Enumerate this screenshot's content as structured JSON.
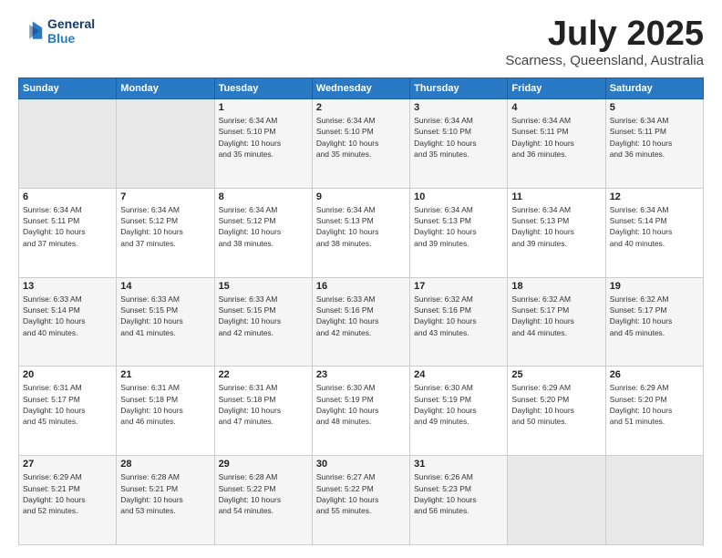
{
  "logo": {
    "line1": "General",
    "line2": "Blue"
  },
  "header": {
    "month": "July 2025",
    "location": "Scarness, Queensland, Australia"
  },
  "weekdays": [
    "Sunday",
    "Monday",
    "Tuesday",
    "Wednesday",
    "Thursday",
    "Friday",
    "Saturday"
  ],
  "weeks": [
    [
      {
        "day": "",
        "info": ""
      },
      {
        "day": "",
        "info": ""
      },
      {
        "day": "1",
        "info": "Sunrise: 6:34 AM\nSunset: 5:10 PM\nDaylight: 10 hours\nand 35 minutes."
      },
      {
        "day": "2",
        "info": "Sunrise: 6:34 AM\nSunset: 5:10 PM\nDaylight: 10 hours\nand 35 minutes."
      },
      {
        "day": "3",
        "info": "Sunrise: 6:34 AM\nSunset: 5:10 PM\nDaylight: 10 hours\nand 35 minutes."
      },
      {
        "day": "4",
        "info": "Sunrise: 6:34 AM\nSunset: 5:11 PM\nDaylight: 10 hours\nand 36 minutes."
      },
      {
        "day": "5",
        "info": "Sunrise: 6:34 AM\nSunset: 5:11 PM\nDaylight: 10 hours\nand 36 minutes."
      }
    ],
    [
      {
        "day": "6",
        "info": "Sunrise: 6:34 AM\nSunset: 5:11 PM\nDaylight: 10 hours\nand 37 minutes."
      },
      {
        "day": "7",
        "info": "Sunrise: 6:34 AM\nSunset: 5:12 PM\nDaylight: 10 hours\nand 37 minutes."
      },
      {
        "day": "8",
        "info": "Sunrise: 6:34 AM\nSunset: 5:12 PM\nDaylight: 10 hours\nand 38 minutes."
      },
      {
        "day": "9",
        "info": "Sunrise: 6:34 AM\nSunset: 5:13 PM\nDaylight: 10 hours\nand 38 minutes."
      },
      {
        "day": "10",
        "info": "Sunrise: 6:34 AM\nSunset: 5:13 PM\nDaylight: 10 hours\nand 39 minutes."
      },
      {
        "day": "11",
        "info": "Sunrise: 6:34 AM\nSunset: 5:13 PM\nDaylight: 10 hours\nand 39 minutes."
      },
      {
        "day": "12",
        "info": "Sunrise: 6:34 AM\nSunset: 5:14 PM\nDaylight: 10 hours\nand 40 minutes."
      }
    ],
    [
      {
        "day": "13",
        "info": "Sunrise: 6:33 AM\nSunset: 5:14 PM\nDaylight: 10 hours\nand 40 minutes."
      },
      {
        "day": "14",
        "info": "Sunrise: 6:33 AM\nSunset: 5:15 PM\nDaylight: 10 hours\nand 41 minutes."
      },
      {
        "day": "15",
        "info": "Sunrise: 6:33 AM\nSunset: 5:15 PM\nDaylight: 10 hours\nand 42 minutes."
      },
      {
        "day": "16",
        "info": "Sunrise: 6:33 AM\nSunset: 5:16 PM\nDaylight: 10 hours\nand 42 minutes."
      },
      {
        "day": "17",
        "info": "Sunrise: 6:32 AM\nSunset: 5:16 PM\nDaylight: 10 hours\nand 43 minutes."
      },
      {
        "day": "18",
        "info": "Sunrise: 6:32 AM\nSunset: 5:17 PM\nDaylight: 10 hours\nand 44 minutes."
      },
      {
        "day": "19",
        "info": "Sunrise: 6:32 AM\nSunset: 5:17 PM\nDaylight: 10 hours\nand 45 minutes."
      }
    ],
    [
      {
        "day": "20",
        "info": "Sunrise: 6:31 AM\nSunset: 5:17 PM\nDaylight: 10 hours\nand 45 minutes."
      },
      {
        "day": "21",
        "info": "Sunrise: 6:31 AM\nSunset: 5:18 PM\nDaylight: 10 hours\nand 46 minutes."
      },
      {
        "day": "22",
        "info": "Sunrise: 6:31 AM\nSunset: 5:18 PM\nDaylight: 10 hours\nand 47 minutes."
      },
      {
        "day": "23",
        "info": "Sunrise: 6:30 AM\nSunset: 5:19 PM\nDaylight: 10 hours\nand 48 minutes."
      },
      {
        "day": "24",
        "info": "Sunrise: 6:30 AM\nSunset: 5:19 PM\nDaylight: 10 hours\nand 49 minutes."
      },
      {
        "day": "25",
        "info": "Sunrise: 6:29 AM\nSunset: 5:20 PM\nDaylight: 10 hours\nand 50 minutes."
      },
      {
        "day": "26",
        "info": "Sunrise: 6:29 AM\nSunset: 5:20 PM\nDaylight: 10 hours\nand 51 minutes."
      }
    ],
    [
      {
        "day": "27",
        "info": "Sunrise: 6:29 AM\nSunset: 5:21 PM\nDaylight: 10 hours\nand 52 minutes."
      },
      {
        "day": "28",
        "info": "Sunrise: 6:28 AM\nSunset: 5:21 PM\nDaylight: 10 hours\nand 53 minutes."
      },
      {
        "day": "29",
        "info": "Sunrise: 6:28 AM\nSunset: 5:22 PM\nDaylight: 10 hours\nand 54 minutes."
      },
      {
        "day": "30",
        "info": "Sunrise: 6:27 AM\nSunset: 5:22 PM\nDaylight: 10 hours\nand 55 minutes."
      },
      {
        "day": "31",
        "info": "Sunrise: 6:26 AM\nSunset: 5:23 PM\nDaylight: 10 hours\nand 56 minutes."
      },
      {
        "day": "",
        "info": ""
      },
      {
        "day": "",
        "info": ""
      }
    ]
  ]
}
